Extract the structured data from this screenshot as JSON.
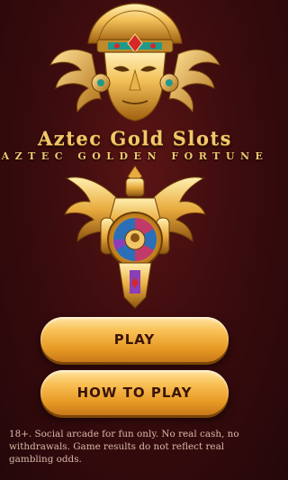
{
  "app": {
    "title": "Aztec Gold Slots",
    "subtitle": "AZTEC GOLDEN FORTUNE"
  },
  "buttons": {
    "play_label": "PLAY",
    "how_to_play_label": "HOW TO PLAY"
  },
  "footer": {
    "disclaimer": "18+. Social arcade for fun only. No real cash, no withdrawals. Game results do not reflect real gambling odds."
  },
  "icons": {
    "logo": "aztec-gold-mask-icon",
    "hero": "golden-winged-warrior-icon"
  },
  "colors": {
    "background": "#3c0c0e",
    "gold": "#f2c76a",
    "button": "#f3b44a",
    "button_text": "#3a1408",
    "disclaimer_text": "#d9b9a8"
  }
}
